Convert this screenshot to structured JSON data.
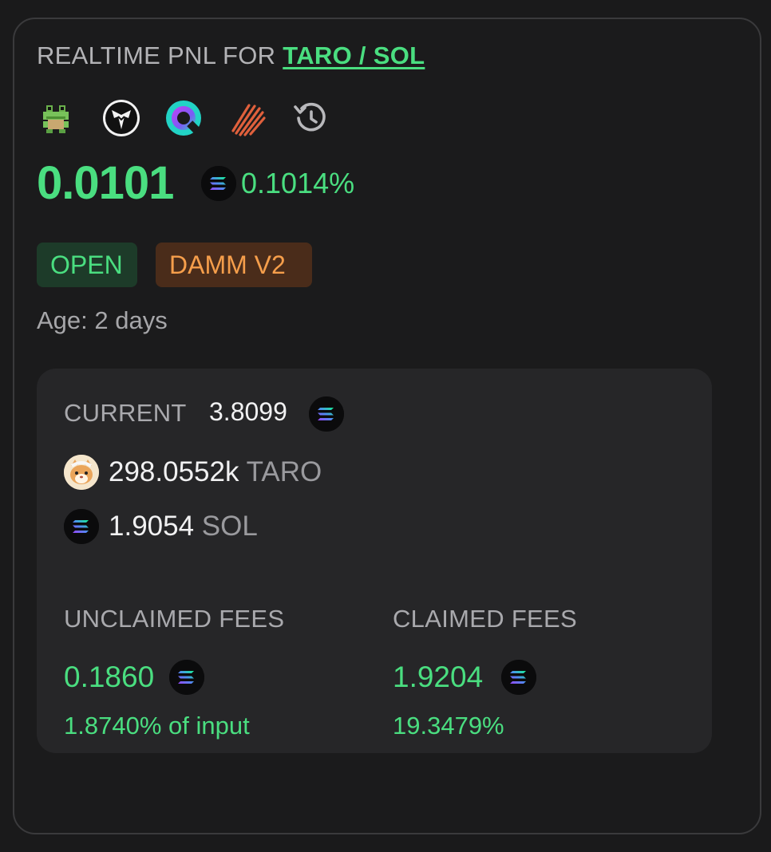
{
  "header": {
    "title_prefix": "REALTIME PNL FOR",
    "pair_link": "TARO / SOL"
  },
  "toolbar_icons": [
    {
      "name": "frog-app-icon"
    },
    {
      "name": "eagle-app-icon"
    },
    {
      "name": "ring-app-icon"
    },
    {
      "name": "striped-app-icon"
    },
    {
      "name": "history-icon"
    }
  ],
  "pnl": {
    "value": "0.0101",
    "percent": "0.1014%"
  },
  "badges": {
    "status": "OPEN",
    "pool_type": "DAMM V2"
  },
  "age": "Age: 2 days",
  "position": {
    "current_label": "CURRENT",
    "current_value": "3.8099",
    "token_a_amount": "298.0552k",
    "token_a_symbol": "TARO",
    "token_b_amount": "1.9054",
    "token_b_symbol": "SOL"
  },
  "fees": {
    "unclaimed_label": "UNCLAIMED FEES",
    "unclaimed_value": "0.1860",
    "unclaimed_pct": "1.8740% of input",
    "claimed_label": "CLAIMED FEES",
    "claimed_value": "1.9204",
    "claimed_pct": "19.3479%"
  },
  "colors": {
    "positive": "#4ade80",
    "damm_badge": "#f59e4b",
    "background": "#1b1b1c"
  }
}
